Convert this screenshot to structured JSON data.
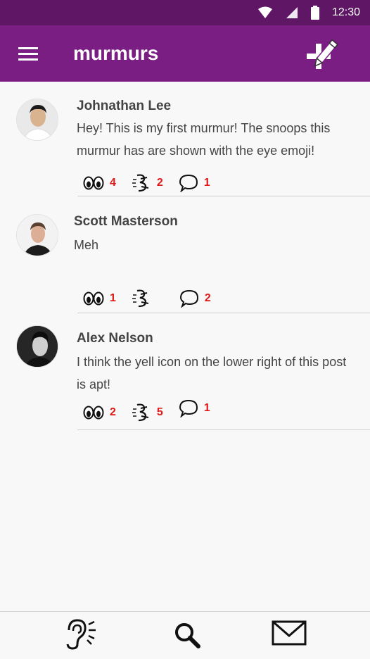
{
  "status_bar": {
    "time": "12:30"
  },
  "app_bar": {
    "title": "murmurs"
  },
  "posts": [
    {
      "author": "Johnathan Lee",
      "text": "Hey! This is my first murmur! The snoops this murmur has are shown with the eye emoji!",
      "snoops": "4",
      "yells": "2",
      "comments": "1"
    },
    {
      "author": "Scott Masterson",
      "text": "Meh",
      "snoops": "1",
      "yells": "",
      "comments": "2"
    },
    {
      "author": "Alex Nelson",
      "text": "I think the yell icon on the lower right of this post is apt!",
      "snoops": "2",
      "yells": "5",
      "comments": "1"
    }
  ],
  "bottom_nav": {
    "items": [
      {
        "icon": "listen-ear-icon"
      },
      {
        "icon": "search-icon"
      },
      {
        "icon": "mail-icon"
      }
    ]
  },
  "colors": {
    "status_bar": "#5e1665",
    "app_bar": "#7a1e84",
    "count": "#e01818",
    "text": "#444444"
  }
}
